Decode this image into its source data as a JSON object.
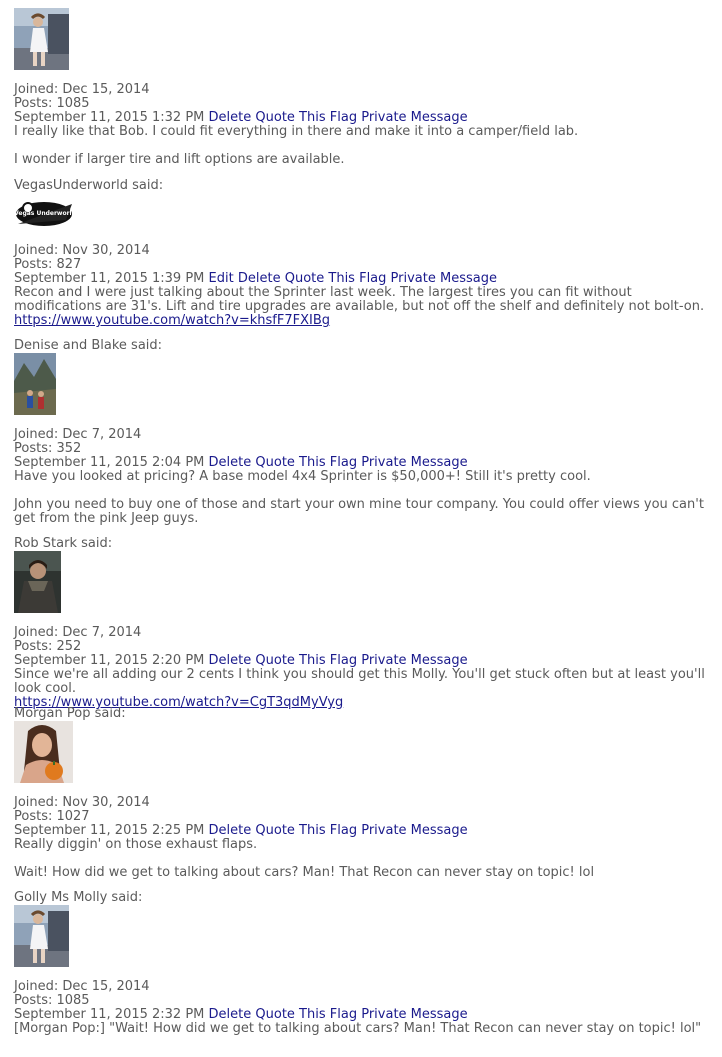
{
  "posts": [
    {
      "joined": "Joined: Dec 15, 2014",
      "posts": "Posts: 1085",
      "date": "September 11, 2015 1:32 PM",
      "actions": [
        "Delete",
        "Quote This",
        "Flag",
        "Private Message"
      ],
      "body1": "I really like that Bob. I could fit everything in there and make it into a camper/field lab.",
      "body2": "I wonder if larger tire and lift options are available."
    },
    {
      "author_said": "VegasUnderworld said:",
      "joined": "Joined: Nov 30, 2014",
      "posts": "Posts: 827",
      "date": "September 11, 2015 1:39 PM",
      "actions": [
        "Edit",
        "Delete",
        "Quote This",
        "Flag",
        "Private Message"
      ],
      "body1": "Recon and I were just talking about the Sprinter last week. The largest tires you can fit without modifications are 31's. Lift and tire upgrades are available, but not off the shelf and definitely not bolt-on.",
      "link": "https://www.youtube.com/watch?v=khsfF7FXIBg"
    },
    {
      "author_said": "Denise and Blake said:",
      "joined": "Joined: Dec 7, 2014",
      "posts": "Posts: 352",
      "date": "September 11, 2015 2:04 PM",
      "actions": [
        "Delete",
        "Quote This",
        "Flag",
        "Private Message"
      ],
      "body1": "Have you looked at pricing? A base model 4x4 Sprinter is $50,000+! Still it's pretty cool.",
      "body2": "John you need to buy one of those and start your own mine tour company. You could offer views you can't get from the pink Jeep guys."
    },
    {
      "author_said": "Rob Stark said:",
      "joined": "Joined: Dec 7, 2014",
      "posts": "Posts: 252",
      "date": "September 11, 2015 2:20 PM",
      "actions": [
        "Delete",
        "Quote This",
        "Flag",
        "Private Message"
      ],
      "body1": "Since we're all adding our 2 cents I think you should get this Molly. You'll get stuck often but at least you'll look cool.",
      "link": "https://www.youtube.com/watch?v=CgT3qdMyVyg"
    },
    {
      "author_said": "Morgan Pop said:",
      "joined": "Joined: Nov 30, 2014",
      "posts": "Posts: 1027",
      "date": "September 11, 2015 2:25 PM",
      "actions": [
        "Delete",
        "Quote This",
        "Flag",
        "Private Message"
      ],
      "body1": "Really diggin' on those exhaust flaps.",
      "body2": "Wait! How did we get to talking about cars? Man! That Recon can never stay on topic! lol"
    },
    {
      "author_said": "Golly Ms Molly said:",
      "joined": "Joined: Dec 15, 2014",
      "posts": "Posts: 1085",
      "date": "September 11, 2015 2:32 PM",
      "actions": [
        "Delete",
        "Quote This",
        "Flag",
        "Private Message"
      ],
      "body1": "[Morgan Pop:] \"Wait! How did we get to talking about cars? Man! That Recon can never stay on topic! lol\""
    }
  ],
  "avatar_labels": {
    "vegas": "Vegas Underworld"
  }
}
